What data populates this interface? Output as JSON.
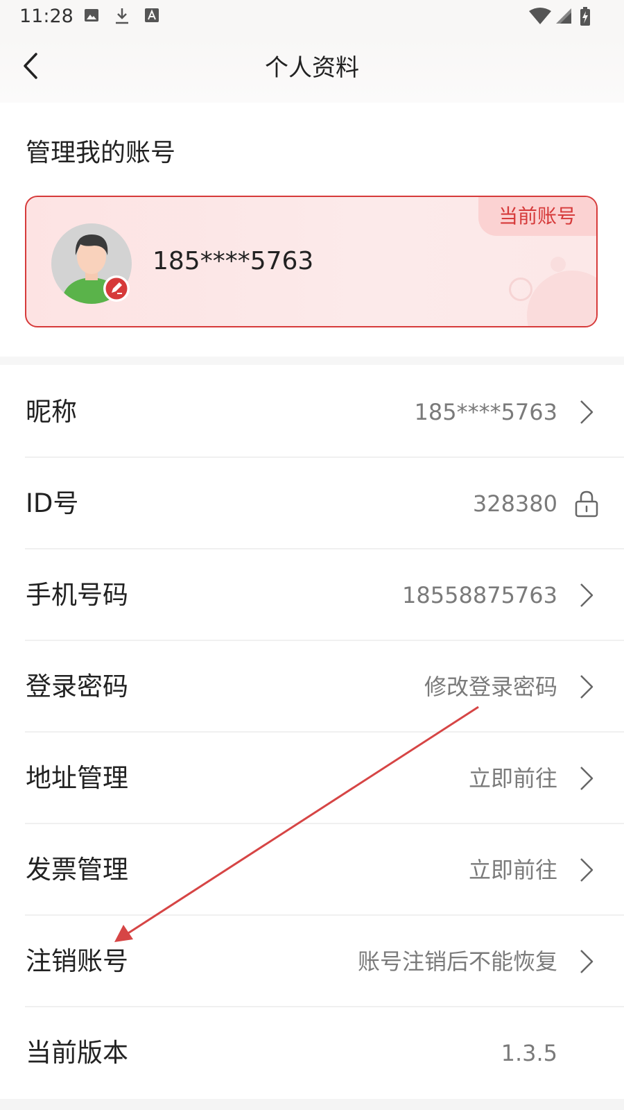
{
  "status_bar": {
    "time": "11:28",
    "icons": [
      "image-icon",
      "download-icon",
      "font-icon",
      "wifi-icon",
      "signal-icon",
      "battery-icon"
    ]
  },
  "header": {
    "title": "个人资料",
    "back_icon": "chevron-left-icon"
  },
  "account_section": {
    "title": "管理我的账号",
    "card": {
      "badge": "当前账号",
      "account_name": "185****5763",
      "accent_color": "#d63a3a"
    }
  },
  "rows": [
    {
      "label": "昵称",
      "value": "185****5763",
      "action_icon": "chevron-right-icon"
    },
    {
      "label": "ID号",
      "value": "328380",
      "action_icon": "lock-icon"
    },
    {
      "label": "手机号码",
      "value": "18558875763",
      "action_icon": "chevron-right-icon"
    },
    {
      "label": "登录密码",
      "value": "修改登录密码",
      "action_icon": "chevron-right-icon"
    },
    {
      "label": "地址管理",
      "value": "立即前往",
      "action_icon": "chevron-right-icon"
    },
    {
      "label": "发票管理",
      "value": "立即前往",
      "action_icon": "chevron-right-icon"
    },
    {
      "label": "注销账号",
      "value": "账号注销后不能恢复",
      "action_icon": "chevron-right-icon"
    },
    {
      "label": "当前版本",
      "value": "1.3.5"
    }
  ]
}
